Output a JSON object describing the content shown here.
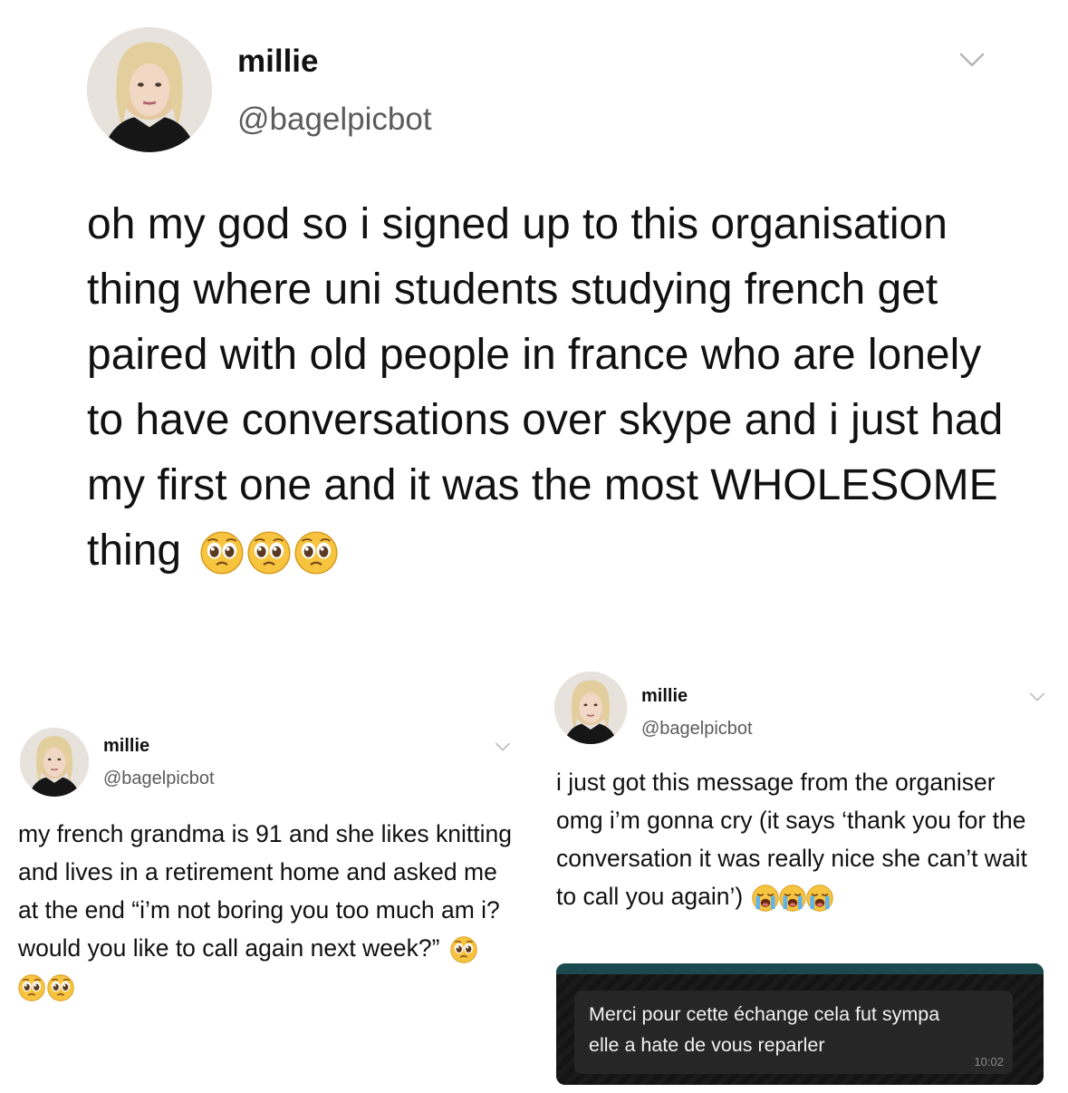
{
  "main_tweet": {
    "name": "millie",
    "handle": "@bagelpicbot",
    "text": "oh my god so i signed up to this organisation thing where uni students studying french get paired with old people in france who are lonely to have conversations over skype and i just had my first one and it was the most WHOLESOME thing",
    "emojis": [
      "pleading-face-icon",
      "pleading-face-icon",
      "pleading-face-icon"
    ]
  },
  "left_tweet": {
    "name": "millie",
    "handle": "@bagelpicbot",
    "text": "my french grandma is 91 and she likes knitting and lives in a retirement home and asked me at the end “i’m not boring you too much am i? would you like to call again next week?”",
    "emojis": [
      "pleading-face-icon",
      "pleading-face-icon",
      "pleading-face-icon"
    ]
  },
  "right_tweet": {
    "name": "millie",
    "handle": "@bagelpicbot",
    "text": "i just got this message from the organiser omg i’m gonna cry (it says ‘thank you for the conversation it was really nice she can’t wait to call you again’)",
    "emojis": [
      "loudly-crying-face-icon",
      "loudly-crying-face-icon",
      "loudly-crying-face-icon"
    ]
  },
  "message": {
    "line1": "Merci pour cette échange cela fut sympa",
    "line2": "elle a hate de vous reparler",
    "time": "10:02"
  },
  "colors": {
    "background": "#ffffff",
    "text": "#111111",
    "handle": "#5b5b5b",
    "message_panel": "#111111",
    "message_bubble": "#262626",
    "message_accent": "#1b4a4e"
  }
}
